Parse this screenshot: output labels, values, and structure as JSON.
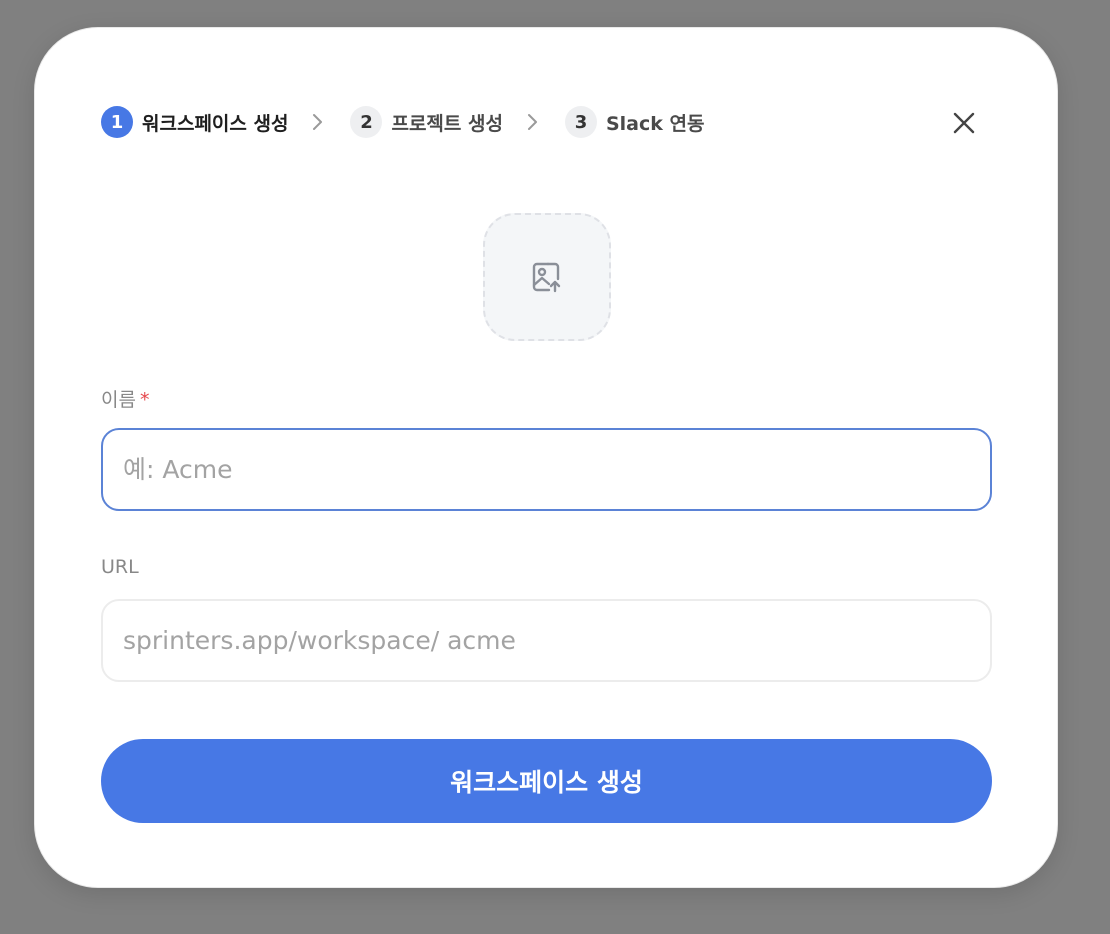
{
  "stepper": {
    "steps": [
      {
        "number": "1",
        "label": "워크스페이스 생성",
        "active": true
      },
      {
        "number": "2",
        "label": "프로젝트 생성",
        "active": false
      },
      {
        "number": "3",
        "label": "Slack 연동",
        "active": false
      }
    ],
    "separator_icon": "chevron-right-icon"
  },
  "close_icon": "close-icon",
  "upload": {
    "icon": "image-upload-icon"
  },
  "form": {
    "name": {
      "label": "이름",
      "required_mark": "*",
      "value": "",
      "placeholder": "예: Acme"
    },
    "url": {
      "label": "URL",
      "value": "",
      "placeholder": "sprinters.app/workspace/ acme"
    }
  },
  "submit": {
    "label": "워크스페이스 생성"
  },
  "colors": {
    "accent": "#4778e5",
    "required": "#e5484d",
    "backdrop": "#808080"
  }
}
